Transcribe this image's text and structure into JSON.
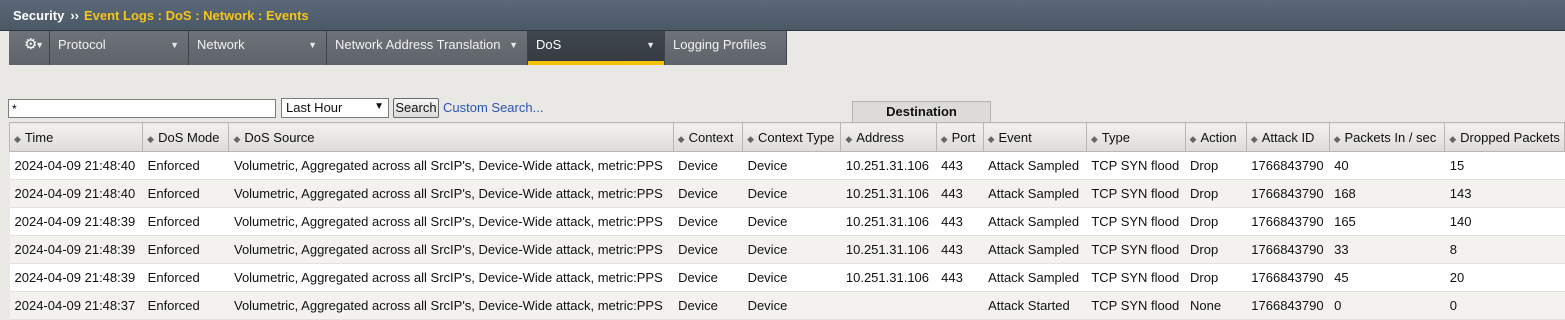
{
  "title": {
    "section": "Security",
    "separator": "››",
    "path": "Event Logs : DoS : Network : Events"
  },
  "nav": {
    "tabs": [
      {
        "label": "Protocol",
        "has_menu": true
      },
      {
        "label": "Network",
        "has_menu": true
      },
      {
        "label": "Network Address Translation",
        "has_menu": true
      },
      {
        "label": "DoS",
        "has_menu": true,
        "active": true
      },
      {
        "label": "Logging Profiles",
        "has_menu": false
      }
    ]
  },
  "search": {
    "value": "*",
    "range": "Last Hour",
    "button": "Search",
    "custom_link": "Custom Search..."
  },
  "table": {
    "group_header": "Destination",
    "columns": [
      "Time",
      "DoS Mode",
      "DoS Source",
      "Context",
      "Context Type",
      "Address",
      "Port",
      "Event",
      "Type",
      "Action",
      "Attack ID",
      "Packets In / sec",
      "Dropped Packets"
    ],
    "rows": [
      [
        "2024-04-09 21:48:40",
        "Enforced",
        "Volumetric, Aggregated across all SrcIP's, Device-Wide attack, metric:PPS",
        "Device",
        "Device",
        "10.251.31.106",
        "443",
        "Attack Sampled",
        "TCP SYN flood",
        "Drop",
        "1766843790",
        "40",
        "15"
      ],
      [
        "2024-04-09 21:48:40",
        "Enforced",
        "Volumetric, Aggregated across all SrcIP's, Device-Wide attack, metric:PPS",
        "Device",
        "Device",
        "10.251.31.106",
        "443",
        "Attack Sampled",
        "TCP SYN flood",
        "Drop",
        "1766843790",
        "168",
        "143"
      ],
      [
        "2024-04-09 21:48:39",
        "Enforced",
        "Volumetric, Aggregated across all SrcIP's, Device-Wide attack, metric:PPS",
        "Device",
        "Device",
        "10.251.31.106",
        "443",
        "Attack Sampled",
        "TCP SYN flood",
        "Drop",
        "1766843790",
        "165",
        "140"
      ],
      [
        "2024-04-09 21:48:39",
        "Enforced",
        "Volumetric, Aggregated across all SrcIP's, Device-Wide attack, metric:PPS",
        "Device",
        "Device",
        "10.251.31.106",
        "443",
        "Attack Sampled",
        "TCP SYN flood",
        "Drop",
        "1766843790",
        "33",
        "8"
      ],
      [
        "2024-04-09 21:48:39",
        "Enforced",
        "Volumetric, Aggregated across all SrcIP's, Device-Wide attack, metric:PPS",
        "Device",
        "Device",
        "10.251.31.106",
        "443",
        "Attack Sampled",
        "TCP SYN flood",
        "Drop",
        "1766843790",
        "45",
        "20"
      ],
      [
        "2024-04-09 21:48:37",
        "Enforced",
        "Volumetric, Aggregated across all SrcIP's, Device-Wide attack, metric:PPS",
        "Device",
        "Device",
        "",
        "",
        "Attack Started",
        "TCP SYN flood",
        "None",
        "1766843790",
        "0",
        "0"
      ]
    ]
  },
  "icons": {
    "gear": "gear-icon",
    "menu_arrow": "chevron-down-icon",
    "sort": "sort-icon"
  },
  "colors": {
    "title_path": "#f5c518",
    "active_tab_underline": "#f2c200",
    "link": "#2a55b8"
  }
}
